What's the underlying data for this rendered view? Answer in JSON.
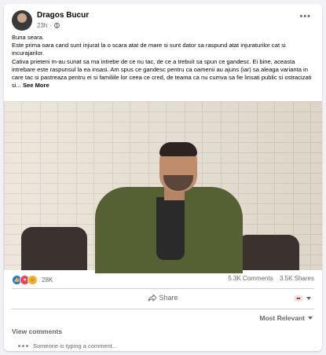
{
  "post": {
    "author": "Dragos Bucur",
    "timestamp": "23h",
    "audience_icon": "globe-icon",
    "more_icon": "more-horizontal-icon",
    "greeting": "Buna seara.",
    "body_lines": [
      "Este prima oara cand sunt injurat la o scara atat de mare si sunt dator sa raspund atat injuraturilor cat si incurajarilor.",
      "Cativa prieteni m-au sunat sa ma intrebe de ce nu tac, de ce a trebuit sa spun ce gandesc. Ei bine, aceasta intrebare este raspunsul la ea insasi. Am spus ce gandesc pentru ca oamenii au ajuns (iar) sa aleaga varianta in care tac si pastreaza pentru ei si familiile lor ceea ce cred, de teama ca nu cumva sa fie linsati public si ostracizati si..."
    ],
    "see_more": "See More"
  },
  "stats": {
    "reaction_icons": [
      "like-icon",
      "love-icon",
      "haha-icon"
    ],
    "reactions_count": "28K",
    "comments": "5.3K Comments",
    "shares": "3.5K Shares"
  },
  "actions": {
    "share_label": "Share"
  },
  "comments": {
    "sort_label": "Most Relevant",
    "view_comments": "View comments",
    "typing_indicator": "Someone is typing a comment..."
  },
  "colors": {
    "background": "#f0f2f5",
    "card": "#ffffff",
    "secondary_text": "#65676b",
    "like_blue": "#1877f2",
    "love_red": "#f33e58",
    "haha_yellow": "#f7b125"
  }
}
